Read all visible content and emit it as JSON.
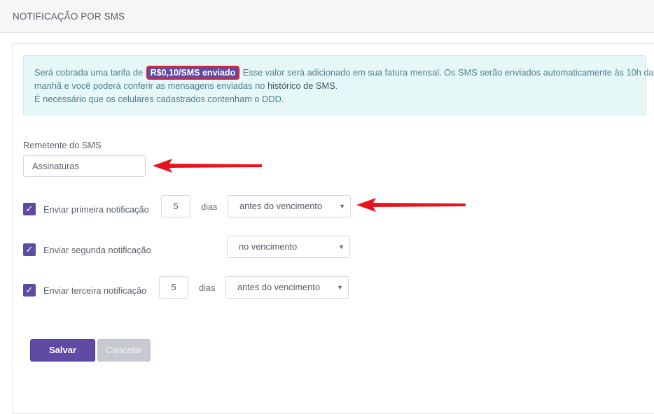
{
  "header": {
    "title": "NOTIFICAÇÃO POR SMS"
  },
  "info": {
    "text_before_price": "Será cobrada uma tarifa de",
    "price": "R$0,10/SMS enviado",
    "text_after_price": "Esse valor será adicionado em sua fatura mensal. Os SMS serão enviados automaticamente às 10h da",
    "line2_prefix": "manhã e você poderá conferir as mensagens enviadas no",
    "line2_link": "histórico de SMS",
    "line2_suffix": ".",
    "line3": "É necessário que os celulares cadastrados contenham o DDD."
  },
  "sender": {
    "label": "Remetente do SMS",
    "value": "Assinaturas"
  },
  "notifications": [
    {
      "label": "Enviar primeira notificação",
      "checked": true,
      "days": "5",
      "days_unit": "dias",
      "when": "antes do vencimento"
    },
    {
      "label": "Enviar segunda notificação",
      "checked": true,
      "days": "",
      "days_unit": "",
      "when": "no vencimento"
    },
    {
      "label": "Enviar terceira notificação",
      "checked": true,
      "days": "5",
      "days_unit": "dias",
      "when": "antes do vencimento"
    }
  ],
  "actions": {
    "save_label": "Salvar",
    "cancel_label": "Cancelar"
  },
  "icons": {
    "checkbox": "check-icon",
    "select": "caret-down-icon",
    "annotation": "red-arrow-icon"
  },
  "colors": {
    "accent": "#5f4aa4",
    "highlight_border": "#d4263a",
    "info_bg": "#e6f7f8",
    "arrow": "#e8141d"
  }
}
